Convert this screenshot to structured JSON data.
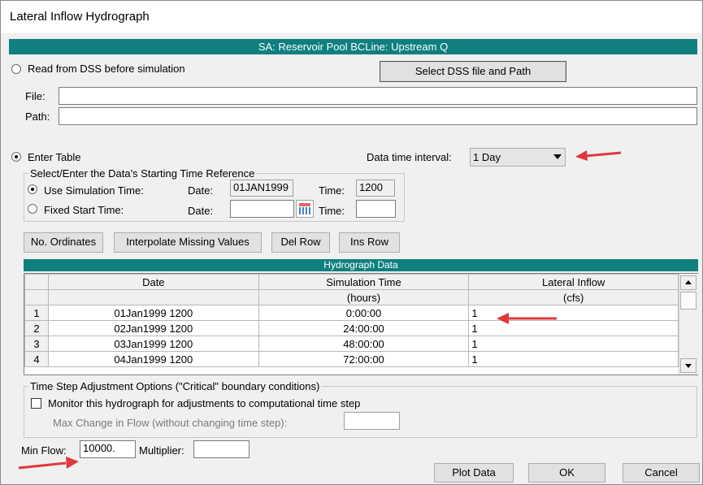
{
  "window": {
    "title": "Lateral Inflow Hydrograph"
  },
  "header_band": "SA: Reservoir Pool BCLine: Upstream Q",
  "dss": {
    "radio_label": "Read from DSS before simulation",
    "select_button": "Select DSS file and Path",
    "file_label": "File:",
    "file_value": "",
    "path_label": "Path:",
    "path_value": ""
  },
  "enter_table": {
    "radio_label": "Enter Table",
    "interval_label": "Data time interval:",
    "interval_value": "1 Day"
  },
  "start_ref": {
    "legend": "Select/Enter the Data's Starting Time Reference",
    "use_sim_label": "Use Simulation Time:",
    "date_label": "Date:",
    "sim_date": "01JAN1999",
    "time_label": "Time:",
    "sim_time": "1200",
    "fixed_label": "Fixed Start Time:",
    "fixed_date": "",
    "fixed_time": ""
  },
  "buttons": {
    "no_ordinates": "No. Ordinates",
    "interpolate": "Interpolate Missing Values",
    "del_row": "Del Row",
    "ins_row": "Ins Row"
  },
  "table": {
    "title": "Hydrograph Data",
    "columns": [
      "Date",
      "Simulation Time",
      "Lateral Inflow"
    ],
    "units": [
      "",
      "(hours)",
      "(cfs)"
    ],
    "rows": [
      {
        "n": "1",
        "date": "01Jan1999 1200",
        "sim": "0:00:00",
        "flow": "1"
      },
      {
        "n": "2",
        "date": "02Jan1999 1200",
        "sim": "24:00:00",
        "flow": "1"
      },
      {
        "n": "3",
        "date": "03Jan1999 1200",
        "sim": "48:00:00",
        "flow": "1"
      },
      {
        "n": "4",
        "date": "04Jan1999 1200",
        "sim": "72:00:00",
        "flow": "1"
      }
    ]
  },
  "timestep": {
    "legend": "Time Step Adjustment Options (\"Critical\" boundary conditions)",
    "monitor_label": "Monitor this hydrograph for adjustments to computational time step",
    "max_change_label": "Max Change in Flow (without changing time step):",
    "max_change_value": ""
  },
  "bottom": {
    "min_flow_label": "Min Flow:",
    "min_flow_value": "10000.",
    "multiplier_label": "Multiplier:",
    "multiplier_value": "",
    "plot_button": "Plot Data",
    "ok_button": "OK",
    "cancel_button": "Cancel"
  },
  "colors": {
    "band": "#0f7f7f",
    "arrow": "#e0383c"
  }
}
